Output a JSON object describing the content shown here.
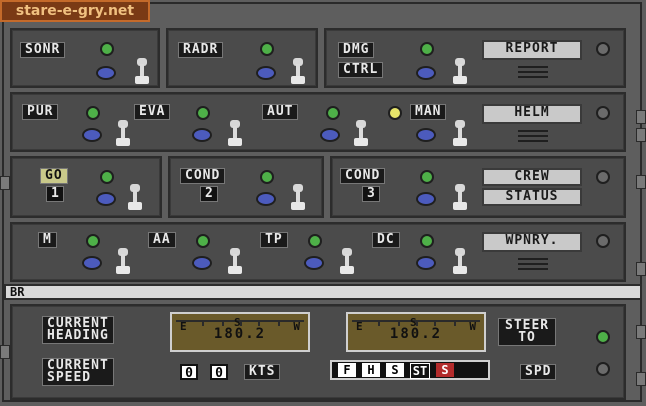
{
  "site": {
    "watermark": "stare-e-gry.net"
  },
  "row1": {
    "sonr": "SONR",
    "radr": "RADR",
    "dmg": "DMG",
    "ctrl": "CTRL",
    "report": "REPORT"
  },
  "row2": {
    "pur": "PUR",
    "eva": "EVA",
    "aut": "AUT",
    "man": "MAN",
    "helm": "HELM"
  },
  "row3": {
    "go": "GO",
    "go_num": "1",
    "cond2": "COND",
    "cond2_num": "2",
    "cond3": "COND",
    "cond3_num": "3",
    "crew": "CREW",
    "status": "STATUS"
  },
  "row4": {
    "m": "M",
    "aa": "AA",
    "tp": "TP",
    "dc": "DC",
    "wpnry": "WPNRY."
  },
  "message": "BR",
  "nav": {
    "current_heading": [
      "CURRENT",
      "HEADING"
    ],
    "current_speed": [
      "CURRENT",
      "SPEED"
    ],
    "heading_gauge_1": {
      "dir": "S",
      "value": "180.2",
      "left_mark": "E",
      "right_mark": "W"
    },
    "heading_gauge_2": {
      "dir": "S",
      "value": "180.2",
      "left_mark": "E",
      "right_mark": "W"
    },
    "steer_to": [
      "STEER",
      "TO"
    ],
    "speed_digits": [
      "0",
      "0"
    ],
    "kts": "KTS",
    "throttle": [
      "F",
      "H",
      "S",
      "ST",
      "S"
    ],
    "spd": "SPD"
  },
  "colors": {
    "panel": "#4b4b4b",
    "led_green": "#4eb048",
    "led_yellow": "#e7e56a",
    "led_blue": "#4c5bbd"
  }
}
